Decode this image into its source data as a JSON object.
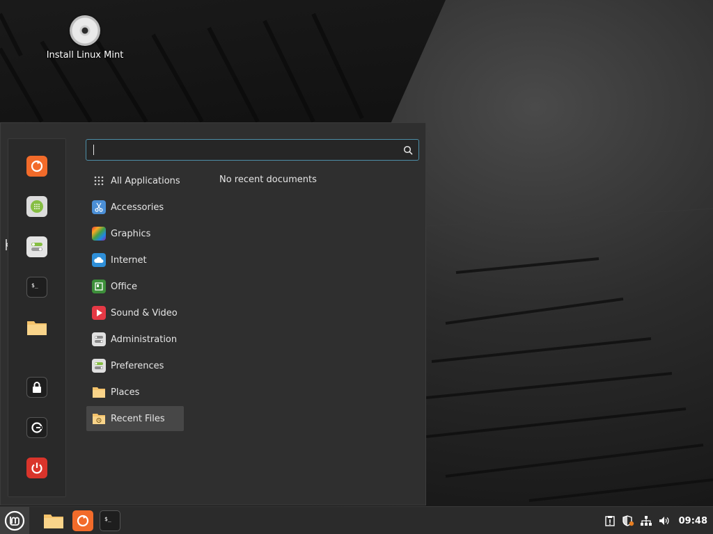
{
  "desktop": {
    "icon_label": "Install Linux Mint"
  },
  "menu": {
    "search": {
      "value": "",
      "placeholder": ""
    },
    "favorites": [
      {
        "name": "firefox-icon"
      },
      {
        "name": "software-manager-icon"
      },
      {
        "name": "system-settings-icon"
      },
      {
        "name": "terminal-icon"
      },
      {
        "name": "files-folder-icon"
      },
      {
        "name": "lock-screen-icon"
      },
      {
        "name": "logout-icon"
      },
      {
        "name": "power-off-icon"
      }
    ],
    "categories": [
      {
        "label": "All Applications",
        "icon": "grid-icon"
      },
      {
        "label": "Accessories",
        "icon": "scissors-icon"
      },
      {
        "label": "Graphics",
        "icon": "color-palette-icon"
      },
      {
        "label": "Internet",
        "icon": "cloud-icon"
      },
      {
        "label": "Office",
        "icon": "document-icon"
      },
      {
        "label": "Sound & Video",
        "icon": "play-icon"
      },
      {
        "label": "Administration",
        "icon": "toggles-icon"
      },
      {
        "label": "Preferences",
        "icon": "toggles-green-icon"
      },
      {
        "label": "Places",
        "icon": "folder-icon"
      },
      {
        "label": "Recent Files",
        "icon": "recent-folder-icon"
      }
    ],
    "selected_category": "Recent Files",
    "no_recent_text": "No recent documents"
  },
  "panel": {
    "clock": "09:48",
    "launchers": [
      "files-folder-icon",
      "firefox-icon",
      "terminal-icon"
    ],
    "tray": [
      "update-manager-icon",
      "shield-icon",
      "network-icon",
      "volume-icon"
    ]
  },
  "colors": {
    "accent": "#4d8fa8",
    "firefox": "#f26b2a",
    "power": "#d9342b",
    "folder": "#f5c36b",
    "mint_green": "#86be43"
  }
}
